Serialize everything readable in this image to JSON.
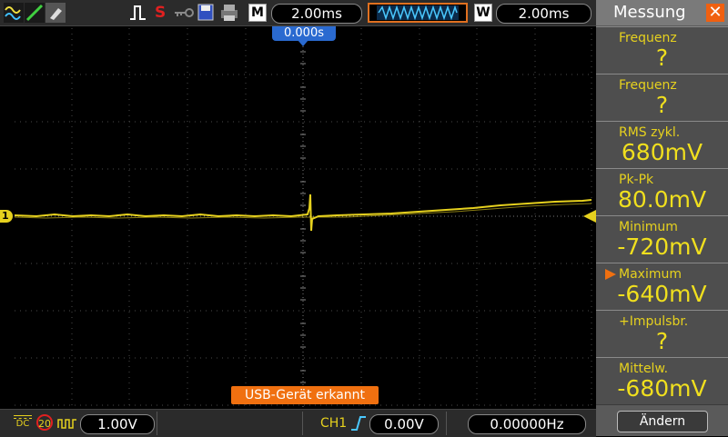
{
  "toolbar": {
    "m_label": "M",
    "timebase": "2.00ms",
    "w_label": "W",
    "window_timebase": "2.00ms",
    "icons": [
      "wave-icon",
      "edit-icon",
      "tool-icon",
      "trigger-pulse-icon",
      "s-icon",
      "key-icon",
      "save-icon",
      "print-icon"
    ]
  },
  "plot": {
    "trigger_position": "0.000s",
    "channel_marker": "1",
    "trace_color": "#e6d11e"
  },
  "status_message": "USB-Gerät  erkannt",
  "bottom": {
    "coupling": "DC",
    "bw_limit": "20",
    "volts_div": "1.00V",
    "trigger_source": "CH1",
    "trigger_level": "0.00V",
    "frequency": "0.00000Hz"
  },
  "sidebar": {
    "title": "Messung",
    "items": [
      {
        "label": "Frequenz",
        "value": "?"
      },
      {
        "label": "Frequenz",
        "value": "?"
      },
      {
        "label": "RMS  zykl.",
        "value": "680mV"
      },
      {
        "label": "Pk-Pk",
        "value": "80.0mV"
      },
      {
        "label": "Minimum",
        "value": "-720mV"
      },
      {
        "label": "Maximum",
        "value": "-640mV"
      },
      {
        "label": "+Impulsbr.",
        "value": "?"
      },
      {
        "label": "Mittelw.",
        "value": "-680mV"
      }
    ],
    "selected_index": 5,
    "change_button": "Ändern"
  }
}
